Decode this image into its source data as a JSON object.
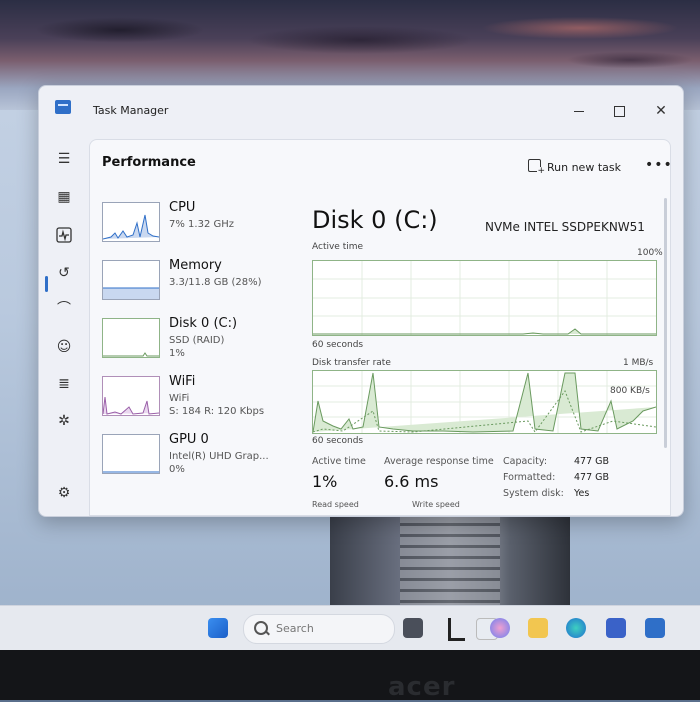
{
  "window": {
    "title": "Task Manager"
  },
  "nav": {
    "items": [
      {
        "name": "hamburger-menu-icon"
      },
      {
        "name": "processes-icon"
      },
      {
        "name": "performance-icon"
      },
      {
        "name": "app-history-icon"
      },
      {
        "name": "startup-apps-icon"
      },
      {
        "name": "users-icon"
      },
      {
        "name": "details-icon"
      },
      {
        "name": "services-icon"
      },
      {
        "name": "settings-icon"
      }
    ]
  },
  "header": {
    "title": "Performance",
    "run_task_label": "Run new task",
    "more_label": "•••"
  },
  "devices": [
    {
      "name": "CPU",
      "sub1": "7% 1.32 GHz",
      "sub2": ""
    },
    {
      "name": "Memory",
      "sub1": "3.3/11.8 GB (28%)",
      "sub2": ""
    },
    {
      "name": "Disk 0 (C:)",
      "sub1": "SSD (RAID)",
      "sub2": "1%"
    },
    {
      "name": "WiFi",
      "sub1": "WiFi",
      "sub2": "S: 184 R: 120 Kbps"
    },
    {
      "name": "GPU 0",
      "sub1": "Intel(R) UHD Grap...",
      "sub2": "0%"
    }
  ],
  "detail": {
    "title": "Disk 0 (C:)",
    "model": "NVMe INTEL SSDPEKNW51",
    "active_time_label": "Active time",
    "active_time_max": "100%",
    "seconds_label_1": "60 seconds",
    "transfer_rate_label": "Disk transfer rate",
    "transfer_rate_max": "1 MB/s",
    "transfer_rate_mid": "800 KB/s",
    "seconds_label_2": "60 seconds",
    "stats": {
      "active_time": {
        "label": "Active time",
        "value": "1%"
      },
      "avg_response": {
        "label": "Average response time",
        "value": "6.6 ms"
      },
      "read_speed_label": "Read speed",
      "write_speed_label": "Write speed"
    },
    "props": [
      {
        "k": "Capacity:",
        "v": "477 GB"
      },
      {
        "k": "Formatted:",
        "v": "477 GB"
      },
      {
        "k": "System disk:",
        "v": "Yes"
      }
    ]
  },
  "taskbar": {
    "search_placeholder": "Search"
  },
  "bezel": {
    "brand": "acer"
  },
  "colors": {
    "accent": "#2f6fc8",
    "disk_graph": "#8fb487"
  }
}
